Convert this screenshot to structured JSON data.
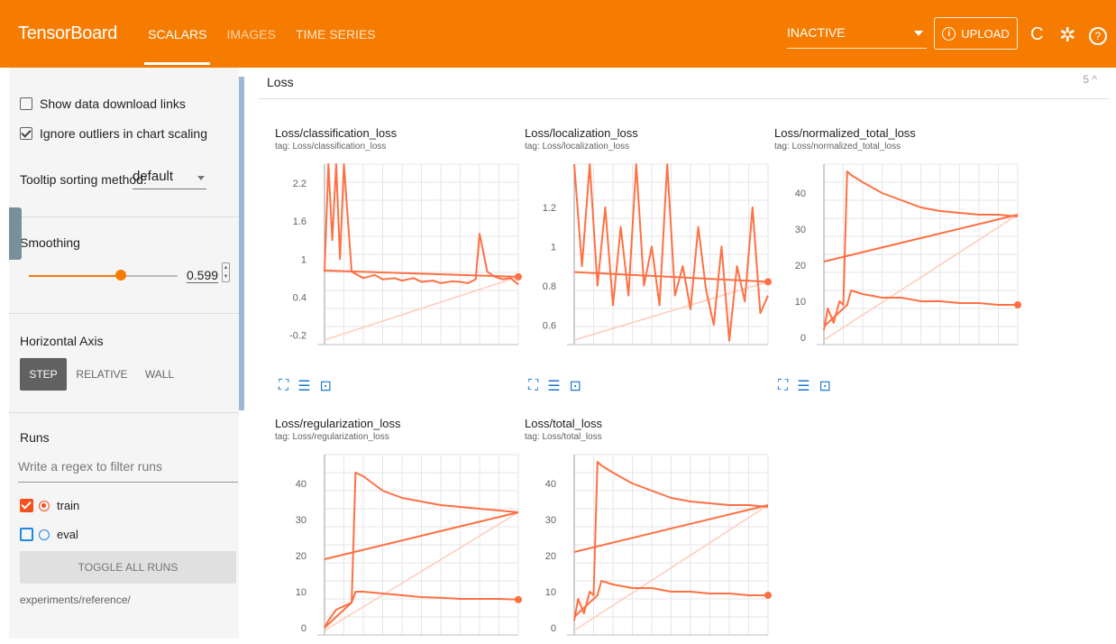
{
  "header": {
    "brand": "TensorBoard",
    "tabs": [
      {
        "label": "SCALARS",
        "active": true
      },
      {
        "label": "IMAGES",
        "active": false
      },
      {
        "label": "TIME SERIES",
        "active": false
      }
    ],
    "status": "INACTIVE",
    "upload": "UPLOAD",
    "upload_info_glyph": "i",
    "icons": {
      "refresh": "C",
      "settings": "✲",
      "help": "?"
    }
  },
  "sidebar": {
    "download_links_label": "Show data download links",
    "download_links_checked": false,
    "ignore_outliers_label": "Ignore outliers in chart scaling",
    "ignore_outliers_checked": true,
    "tooltip_label": "Tooltip sorting method:",
    "tooltip_value": "default",
    "smoothing_label": "Smoothing",
    "smoothing_value": "0.599",
    "smoothing_fraction": 0.62,
    "horizontal_axis_label": "Horizontal Axis",
    "axis_options": [
      "STEP",
      "RELATIVE",
      "WALL"
    ],
    "axis_active": "STEP",
    "runs_label": "Runs",
    "runs_filter_placeholder": "Write a regex to filter runs",
    "runs": [
      {
        "name": "train",
        "checked": true
      },
      {
        "name": "eval",
        "checked": false
      }
    ],
    "toggle_all": "TOGGLE ALL RUNS",
    "experiment_path": "experiments/reference/"
  },
  "main": {
    "group_title": "Loss",
    "group_count": "5 ^"
  },
  "colors": {
    "accent": "#f57c00",
    "series": "#ff7043",
    "active_run": "#f4511e",
    "link": "#1976d2"
  },
  "chart_data": [
    {
      "type": "line",
      "title": "Loss/classification_loss",
      "tag": "tag: Loss/classification_loss",
      "yticks": [
        -0.2,
        0.4,
        1,
        1.6,
        2.2
      ],
      "ylim": [
        -0.35,
        2.5
      ],
      "series": [
        {
          "x": [
            0,
            0.02,
            0.04,
            0.06,
            0.08,
            0.1,
            0.14,
            0.2,
            0.26,
            0.3,
            0.36,
            0.4,
            0.46,
            0.5,
            0.56,
            0.6,
            0.66,
            0.7,
            0.74,
            0.78,
            0.8,
            0.84,
            0.88,
            0.92,
            0.96,
            1.0
          ],
          "values": [
            0.8,
            2.5,
            1.3,
            2.5,
            1.0,
            2.5,
            0.8,
            0.7,
            0.75,
            0.68,
            0.7,
            0.66,
            0.7,
            0.64,
            0.66,
            0.62,
            0.65,
            0.64,
            0.62,
            0.68,
            1.4,
            0.8,
            0.72,
            0.68,
            0.7,
            0.6
          ]
        },
        {
          "x": [
            0,
            1.0
          ],
          "values": [
            0.82,
            0.72
          ]
        }
      ]
    },
    {
      "type": "line",
      "title": "Loss/localization_loss",
      "tag": "tag: Loss/localization_loss",
      "yticks": [
        0.6,
        0.8,
        1,
        1.2
      ],
      "ylim": [
        0.5,
        1.42
      ],
      "series": [
        {
          "x": [
            0,
            0.04,
            0.08,
            0.12,
            0.16,
            0.2,
            0.24,
            0.28,
            0.32,
            0.36,
            0.4,
            0.44,
            0.48,
            0.52,
            0.56,
            0.6,
            0.64,
            0.68,
            0.72,
            0.76,
            0.8,
            0.84,
            0.88,
            0.92,
            0.96,
            1.0
          ],
          "values": [
            1.42,
            0.9,
            1.42,
            0.8,
            1.2,
            0.7,
            1.1,
            0.75,
            1.42,
            0.8,
            1.0,
            0.7,
            1.42,
            0.75,
            0.9,
            0.68,
            1.1,
            0.78,
            0.6,
            1.0,
            0.52,
            0.9,
            0.72,
            1.2,
            0.66,
            0.75
          ]
        },
        {
          "x": [
            0,
            1.0
          ],
          "values": [
            0.87,
            0.82
          ]
        }
      ]
    },
    {
      "type": "line",
      "title": "Loss/normalized_total_loss",
      "tag": "tag: Loss/normalized_total_loss",
      "yticks": [
        0,
        10,
        20,
        30,
        40
      ],
      "ylim": [
        -2,
        48
      ],
      "series": [
        {
          "x": [
            0,
            0.02,
            0.05,
            0.08,
            0.1,
            0.12,
            0.14,
            0.2,
            0.3,
            0.4,
            0.5,
            0.6,
            0.7,
            0.8,
            0.9,
            1.0
          ],
          "values": [
            2,
            8,
            4,
            10,
            9,
            46,
            45,
            43,
            40,
            38,
            36,
            35,
            34.5,
            34,
            34,
            33.5
          ]
        },
        {
          "x": [
            0,
            1.0
          ],
          "values": [
            21,
            34
          ]
        },
        {
          "x": [
            0,
            0.12,
            0.14,
            0.2,
            0.3,
            0.4,
            0.5,
            0.6,
            0.7,
            0.8,
            0.9,
            1.0
          ],
          "values": [
            3,
            9,
            13,
            12,
            11,
            11,
            10,
            10,
            9.5,
            9.5,
            9,
            9
          ]
        }
      ]
    },
    {
      "type": "line",
      "title": "Loss/regularization_loss",
      "tag": "tag: Loss/regularization_loss",
      "yticks": [
        0,
        10,
        20,
        30,
        40
      ],
      "ylim": [
        -2,
        48
      ],
      "series": [
        {
          "x": [
            0,
            0.02,
            0.06,
            0.1,
            0.14,
            0.16,
            0.2,
            0.3,
            0.4,
            0.5,
            0.6,
            0.7,
            0.8,
            0.9,
            1.0
          ],
          "values": [
            0,
            2,
            5,
            6,
            7,
            43,
            42,
            38,
            36,
            35,
            34,
            33.5,
            33,
            32.5,
            32
          ]
        },
        {
          "x": [
            0,
            1.0
          ],
          "values": [
            19,
            32
          ]
        },
        {
          "x": [
            0,
            0.14,
            0.16,
            0.2,
            0.3,
            0.4,
            0.5,
            0.6,
            0.7,
            0.8,
            0.9,
            1.0
          ],
          "values": [
            0,
            7,
            10,
            10,
            9.5,
            9,
            8.5,
            8.3,
            8,
            8,
            8,
            7.8
          ]
        }
      ]
    },
    {
      "type": "line",
      "title": "Loss/total_loss",
      "tag": "tag: Loss/total_loss",
      "yticks": [
        0,
        10,
        20,
        30,
        40
      ],
      "ylim": [
        -2,
        48
      ],
      "series": [
        {
          "x": [
            0,
            0.02,
            0.05,
            0.08,
            0.1,
            0.12,
            0.14,
            0.2,
            0.3,
            0.4,
            0.5,
            0.6,
            0.7,
            0.8,
            0.9,
            1.0
          ],
          "values": [
            2,
            8,
            4,
            10,
            9,
            46,
            45,
            43,
            40,
            38,
            36,
            35,
            34.5,
            34,
            34,
            33.5
          ]
        },
        {
          "x": [
            0,
            1.0
          ],
          "values": [
            21,
            34
          ]
        },
        {
          "x": [
            0,
            0.12,
            0.14,
            0.2,
            0.3,
            0.4,
            0.5,
            0.6,
            0.7,
            0.8,
            0.9,
            1.0
          ],
          "values": [
            3,
            9,
            13,
            12,
            11,
            11,
            10,
            10,
            9.5,
            9.5,
            9,
            9
          ]
        }
      ]
    }
  ]
}
